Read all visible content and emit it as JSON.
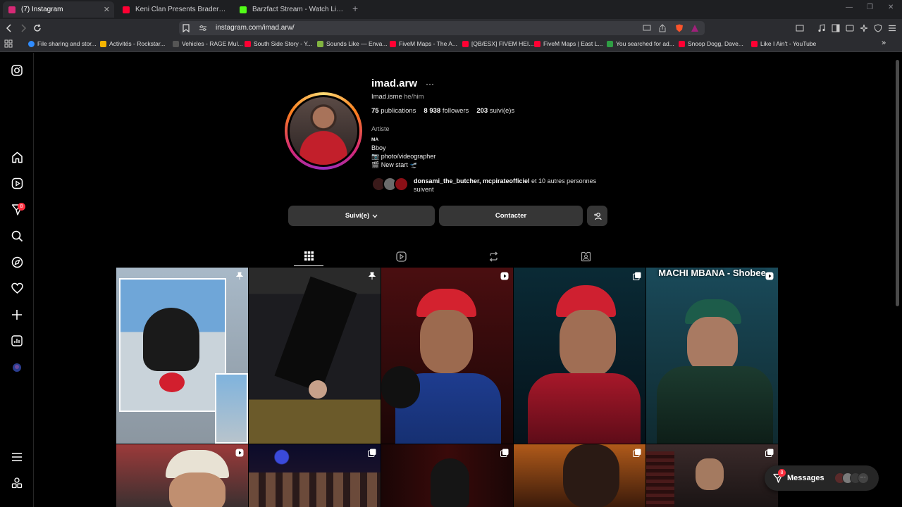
{
  "browser": {
    "tabs": [
      {
        "title": "(7) Instagram",
        "active": true,
        "color": "#d62976"
      },
      {
        "title": "Keni Clan Presents Braderz - F'Dlam",
        "active": false,
        "color": "#ff0033"
      },
      {
        "title": "Barzfact Stream - Watch Live on Kick",
        "active": false,
        "color": "#53fc18"
      }
    ],
    "url": "instagram.com/imad.arw/",
    "bookmarks": [
      {
        "label": "File sharing and stor...",
        "color": "#2f8cff"
      },
      {
        "label": "Activités - Rockstar...",
        "color": "#f4b400"
      },
      {
        "label": "Vehicles - RAGE Mul...",
        "color": "#333333"
      },
      {
        "label": "South Side Story - Y...",
        "color": "#ff0033"
      },
      {
        "label": "Sounds Like — Enva...",
        "color": "#82b541"
      },
      {
        "label": "FiveM Maps - The A...",
        "color": "#ff0033"
      },
      {
        "label": "[QB/ESX] FIVEM HEI...",
        "color": "#ff0033"
      },
      {
        "label": "FiveM Maps | East L...",
        "color": "#ff0033"
      },
      {
        "label": "You searched for ad...",
        "color": "#2f9e44"
      },
      {
        "label": "Snoop Dogg, Dave...",
        "color": "#ff0033"
      },
      {
        "label": "Like I Ain't - YouTube",
        "color": "#ff0033"
      }
    ]
  },
  "nav": {
    "notifications_badge": "8"
  },
  "profile": {
    "username": "imad.arw",
    "more": "···",
    "full_name": "Imad.isme",
    "pronouns": "he/him",
    "stats": {
      "posts_count": "75",
      "posts_label": "publications",
      "followers_count": "8 938",
      "followers_label": "followers",
      "following_count": "203",
      "following_label": "suivi(e)s"
    },
    "category": "Artiste",
    "bio_lines": [
      "MA",
      "Bboy",
      "📷 photo/videographer",
      "🎬 New start 🛫"
    ],
    "followed_by": {
      "names": "donsami_the_butcher, mcpirateofficiel",
      "suffix": " et 10 autres personnes suivent"
    },
    "buttons": {
      "following": "Suivi(e)",
      "contact": "Contacter"
    }
  },
  "grid": {
    "post5_caption": "MACHI MBANA - Shobee"
  },
  "messages": {
    "label": "Messages",
    "badge": "8"
  }
}
